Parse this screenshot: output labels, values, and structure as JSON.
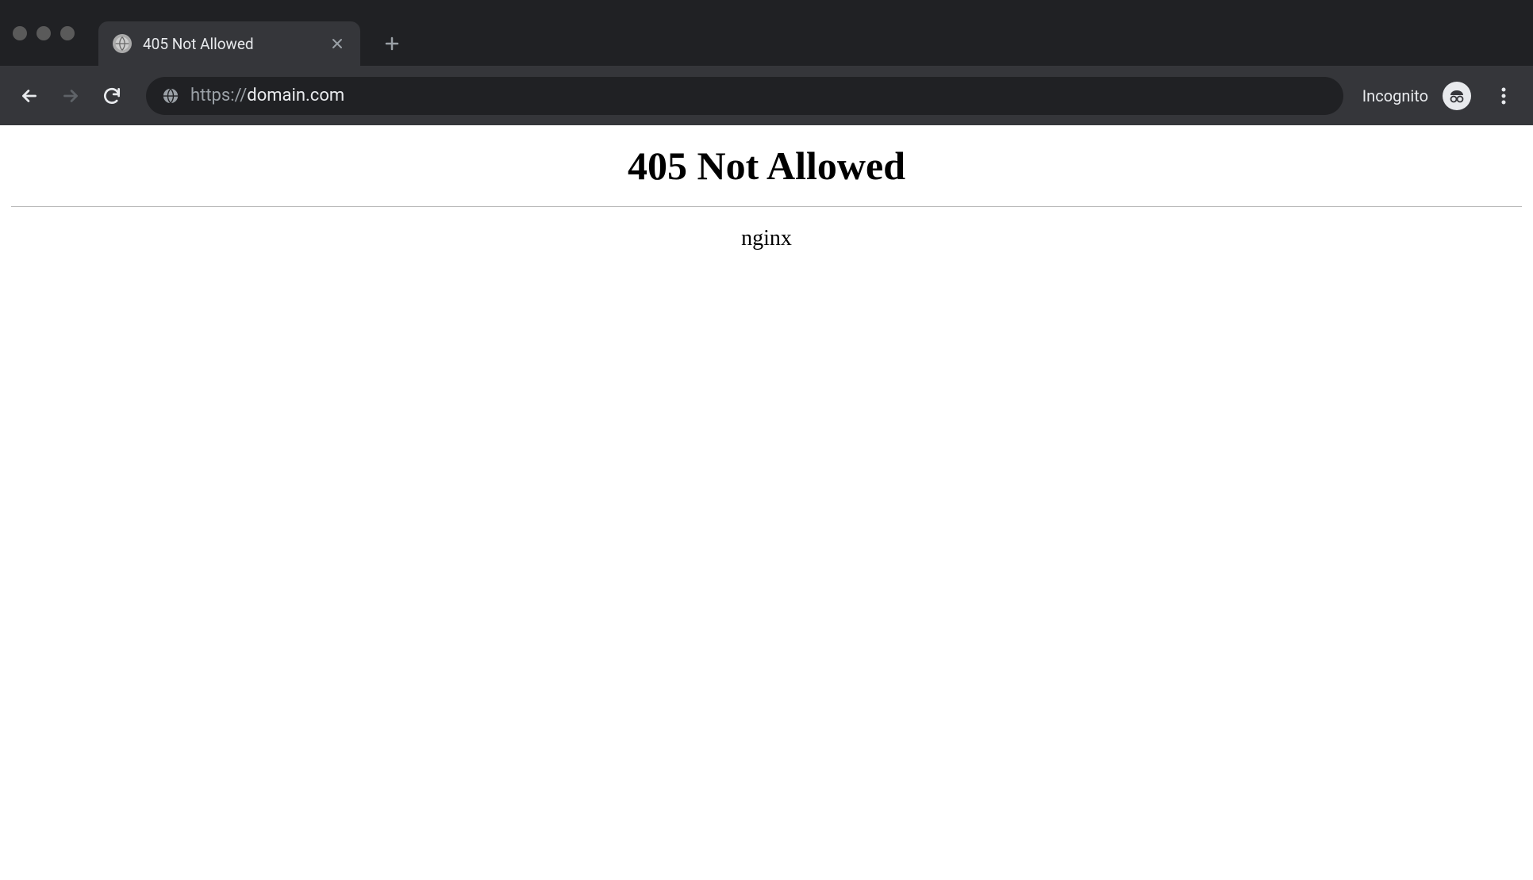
{
  "browser": {
    "tab": {
      "title": "405 Not Allowed"
    },
    "address_bar": {
      "scheme": "https://",
      "host": "domain.com"
    },
    "incognito_label": "Incognito"
  },
  "page": {
    "heading": "405 Not Allowed",
    "server": "nginx"
  }
}
